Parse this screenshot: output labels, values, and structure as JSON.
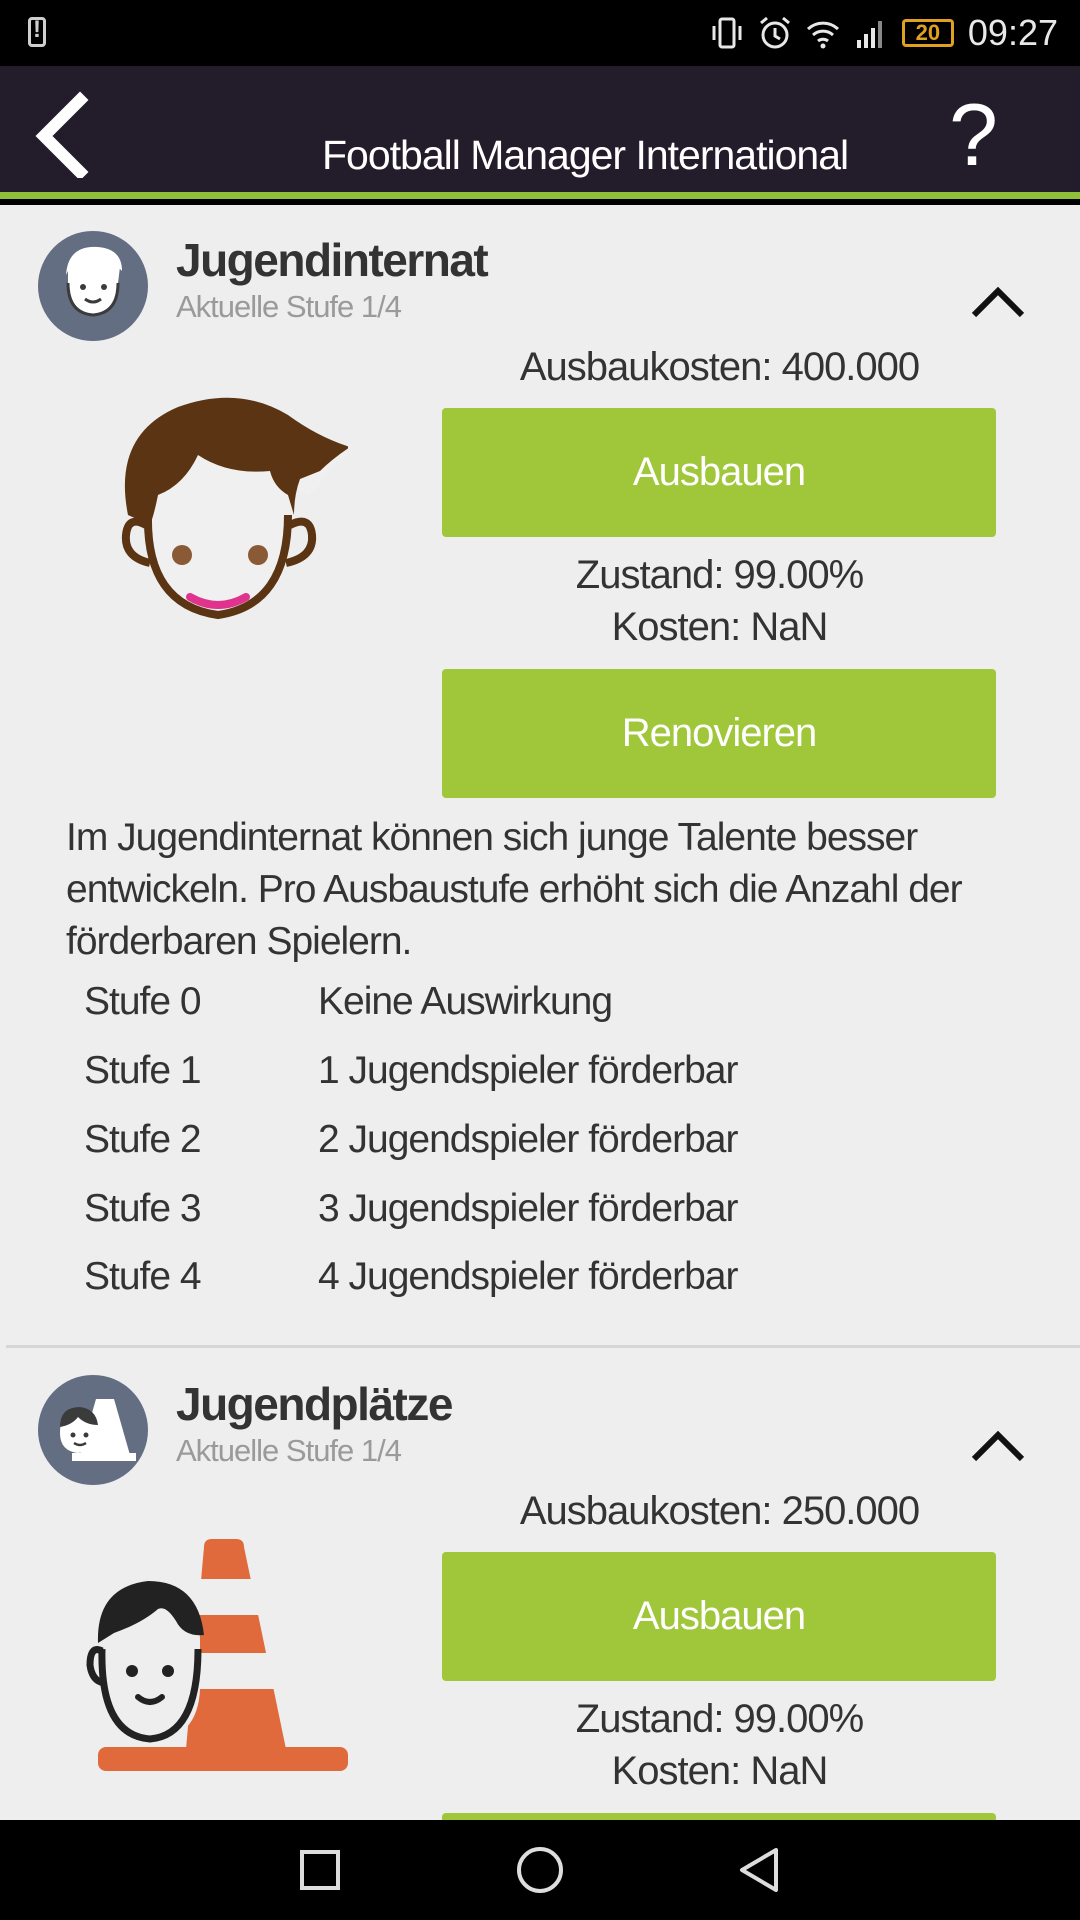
{
  "status_bar": {
    "time": "09:27",
    "battery_level": "20",
    "icons": [
      "warning-icon",
      "vibrate-icon",
      "alarm-icon",
      "wifi-icon",
      "signal-icon",
      "battery-icon"
    ]
  },
  "app_bar": {
    "title": "Football Manager International",
    "back_icon": "back-arrow-icon",
    "help_label": "?"
  },
  "sections": [
    {
      "title": "Jugendinternat",
      "level": "Aktuelle Stufe 1/4",
      "upgrade_cost": "Ausbaukosten: 400.000",
      "upgrade_label": "Ausbauen",
      "condition": "Zustand: 99.00%",
      "cost": "Kosten: NaN",
      "renovate_label": "Renovieren",
      "description": "Im Jugendinternat können sich junge Talente besser entwickeln. Pro Ausbaustufe erhöht sich die Anzahl der förderbaren Spielern.",
      "levels": [
        {
          "name": "Stufe 0",
          "effect": "Keine Auswirkung"
        },
        {
          "name": "Stufe 1",
          "effect": "1 Jugendspieler förderbar"
        },
        {
          "name": "Stufe 2",
          "effect": "2 Jugendspieler förderbar"
        },
        {
          "name": "Stufe 3",
          "effect": "3 Jugendspieler förderbar"
        },
        {
          "name": "Stufe 4",
          "effect": "4 Jugendspieler förderbar"
        }
      ]
    },
    {
      "title": "Jugendplätze",
      "level": "Aktuelle Stufe 1/4",
      "upgrade_cost": "Ausbaukosten: 250.000",
      "upgrade_label": "Ausbauen",
      "condition": "Zustand: 99.00%",
      "cost": "Kosten: NaN"
    }
  ],
  "colors": {
    "app_bar": "#231c2b",
    "accent_green": "#a0c63a",
    "avatar_bg": "#646e82",
    "background": "#eeeeee",
    "cone_orange": "#e06a3c"
  }
}
